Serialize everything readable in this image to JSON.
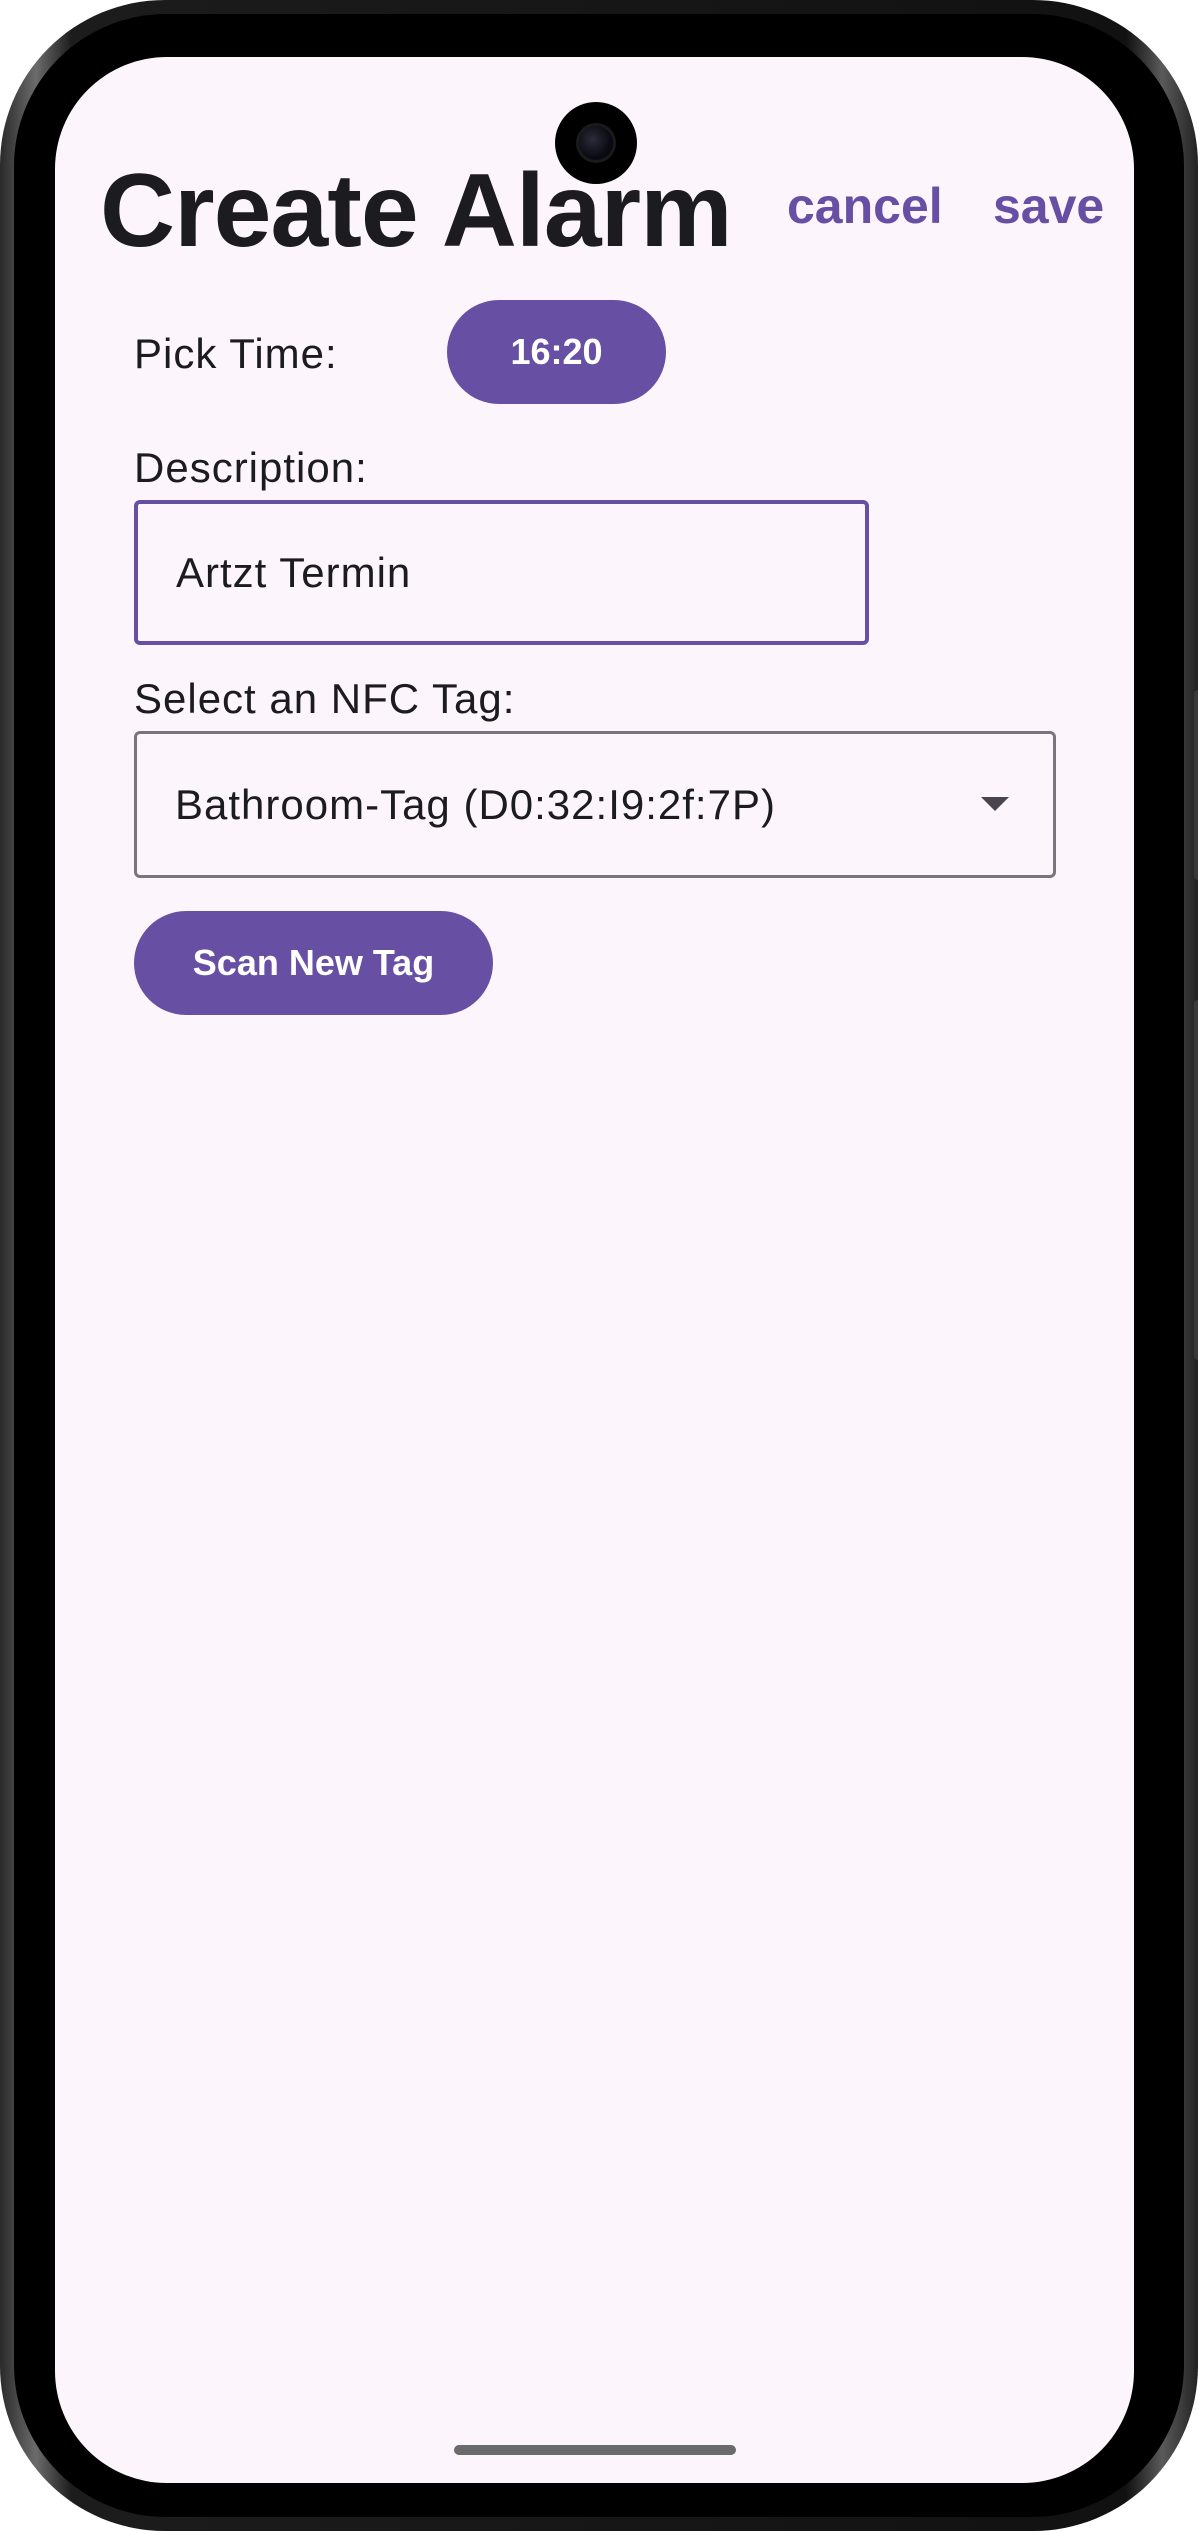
{
  "header": {
    "title": "Create Alarm",
    "cancel_label": "cancel",
    "save_label": "save"
  },
  "time": {
    "label": "Pick Time:",
    "value": "16:20"
  },
  "description": {
    "label": "Description:",
    "value": "Artzt Termin"
  },
  "nfc": {
    "label": "Select an NFC Tag:",
    "selected": "Bathroom-Tag (D0:32:I9:2f:7P)",
    "scan_label": "Scan New Tag"
  },
  "colors": {
    "accent": "#6750a4",
    "background": "#fdf5fc",
    "text": "#1c1b1f",
    "outline": "#79747e"
  },
  "icons": {
    "dropdown": "arrow-drop-down-icon",
    "camera": "front-camera-icon"
  }
}
